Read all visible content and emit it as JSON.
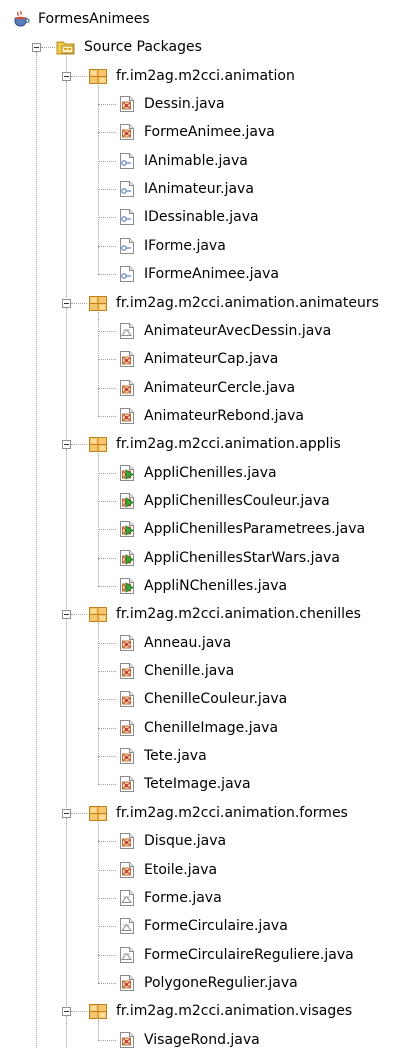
{
  "project": {
    "name": "FormesAnimees",
    "icon": "java-coffee-cup-icon"
  },
  "source_root": {
    "name": "Source Packages",
    "icon": "source-folder-icon"
  },
  "packages": [
    {
      "name": "fr.im2ag.m2cci.animation",
      "files": [
        {
          "name": "Dessin.java",
          "type": "class"
        },
        {
          "name": "FormeAnimee.java",
          "type": "class"
        },
        {
          "name": "IAnimable.java",
          "type": "interface"
        },
        {
          "name": "IAnimateur.java",
          "type": "interface"
        },
        {
          "name": "IDessinable.java",
          "type": "interface"
        },
        {
          "name": "IForme.java",
          "type": "interface"
        },
        {
          "name": "IFormeAnimee.java",
          "type": "interface"
        }
      ]
    },
    {
      "name": "fr.im2ag.m2cci.animation.animateurs",
      "files": [
        {
          "name": "AnimateurAvecDessin.java",
          "type": "abstract"
        },
        {
          "name": "AnimateurCap.java",
          "type": "class"
        },
        {
          "name": "AnimateurCercle.java",
          "type": "class"
        },
        {
          "name": "AnimateurRebond.java",
          "type": "class"
        }
      ]
    },
    {
      "name": "fr.im2ag.m2cci.animation.applis",
      "files": [
        {
          "name": "AppliChenilles.java",
          "type": "main"
        },
        {
          "name": "AppliChenillesCouleur.java",
          "type": "main"
        },
        {
          "name": "AppliChenillesParametrees.java",
          "type": "main"
        },
        {
          "name": "AppliChenillesStarWars.java",
          "type": "main"
        },
        {
          "name": "AppliNChenilles.java",
          "type": "main"
        }
      ]
    },
    {
      "name": "fr.im2ag.m2cci.animation.chenilles",
      "files": [
        {
          "name": "Anneau.java",
          "type": "class"
        },
        {
          "name": "Chenille.java",
          "type": "class"
        },
        {
          "name": "ChenilleCouleur.java",
          "type": "class"
        },
        {
          "name": "ChenilleImage.java",
          "type": "class"
        },
        {
          "name": "Tete.java",
          "type": "class"
        },
        {
          "name": "TeteImage.java",
          "type": "class"
        }
      ]
    },
    {
      "name": "fr.im2ag.m2cci.animation.formes",
      "files": [
        {
          "name": "Disque.java",
          "type": "class"
        },
        {
          "name": "Etoile.java",
          "type": "class"
        },
        {
          "name": "Forme.java",
          "type": "abstract"
        },
        {
          "name": "FormeCirculaire.java",
          "type": "abstract"
        },
        {
          "name": "FormeCirculaireReguliere.java",
          "type": "abstract"
        },
        {
          "name": "PolygoneRegulier.java",
          "type": "class"
        }
      ]
    },
    {
      "name": "fr.im2ag.m2cci.animation.visages",
      "files": [
        {
          "name": "VisageRond.java",
          "type": "class"
        }
      ]
    }
  ],
  "colors": {
    "tree_line": "#a0a0a0",
    "folder": "#e8b84a",
    "package": "#f0a830",
    "interface": "#6a8fc0",
    "run": "#3aa63a",
    "class_badge": "#c8403a"
  }
}
